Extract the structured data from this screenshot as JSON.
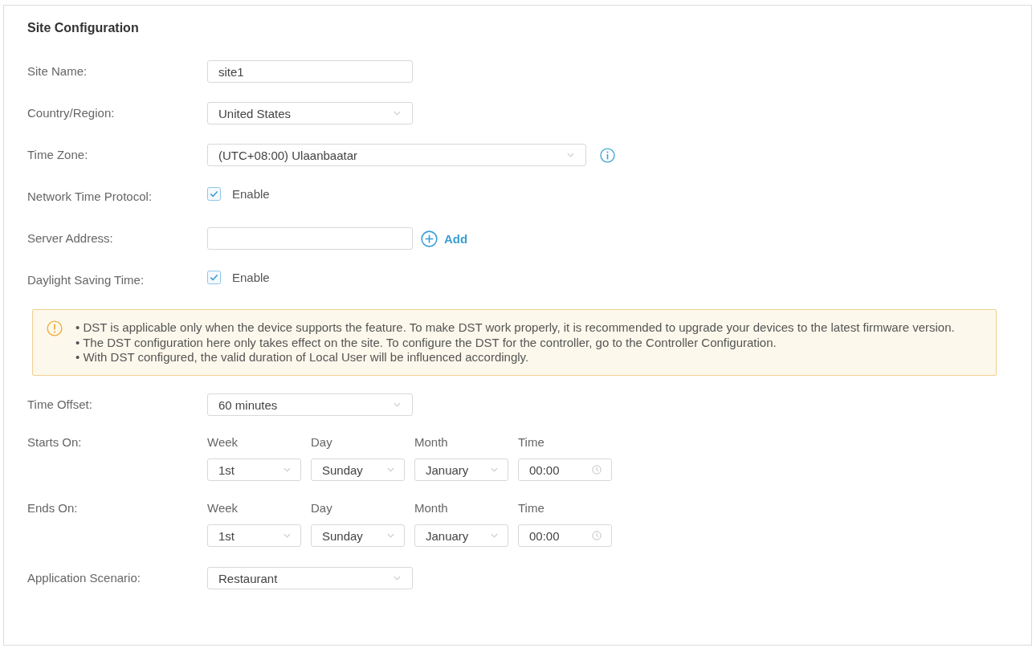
{
  "title": "Site Configuration",
  "rows": [
    {
      "kind": "text",
      "label": "Site Name:",
      "value": "site1"
    },
    {
      "kind": "select",
      "label": "Country/Region:",
      "value": "United States"
    },
    {
      "kind": "select",
      "label": "Time Zone:",
      "value": "(UTC+08:00) Ulaanbaatar",
      "wide": true,
      "info": true
    },
    {
      "kind": "checkbox",
      "label": "Network Time Protocol:",
      "option": "Enable",
      "checked": true
    },
    {
      "kind": "text",
      "label": "Server Address:",
      "action": "Add"
    },
    {
      "kind": "checkbox",
      "label": "Daylight Saving Time:",
      "option": "Enable",
      "checked": true
    },
    {
      "kind": "notice",
      "lines": [
        "• DST is applicable only when the device supports the feature. To make DST work properly, it is recommended to upgrade your devices to the latest firmware version.",
        "• The DST configuration here only takes effect on the site. To configure the DST for the controller, go to the Controller Configuration.",
        "• With DST configured, the valid duration of Local User will be influenced accordingly."
      ]
    },
    {
      "kind": "select",
      "label": "Time Offset:",
      "value": "60 minutes"
    },
    {
      "kind": "schedule",
      "label": "Starts On:",
      "parts": [
        {
          "kind": "select",
          "label": "Week",
          "value": "1st"
        },
        {
          "kind": "select",
          "label": "Day",
          "value": "Sunday"
        },
        {
          "kind": "select",
          "label": "Month",
          "value": "January"
        },
        {
          "kind": "time",
          "label": "Time",
          "value": "00:00"
        }
      ]
    },
    {
      "kind": "schedule",
      "label": "Ends On:",
      "parts": [
        {
          "kind": "select",
          "label": "Week",
          "value": "1st"
        },
        {
          "kind": "select",
          "label": "Day",
          "value": "Sunday"
        },
        {
          "kind": "select",
          "label": "Month",
          "value": "January"
        },
        {
          "kind": "time",
          "label": "Time",
          "value": "00:00"
        }
      ]
    },
    {
      "kind": "select",
      "label": "Application Scenario:",
      "value": "Restaurant"
    }
  ]
}
